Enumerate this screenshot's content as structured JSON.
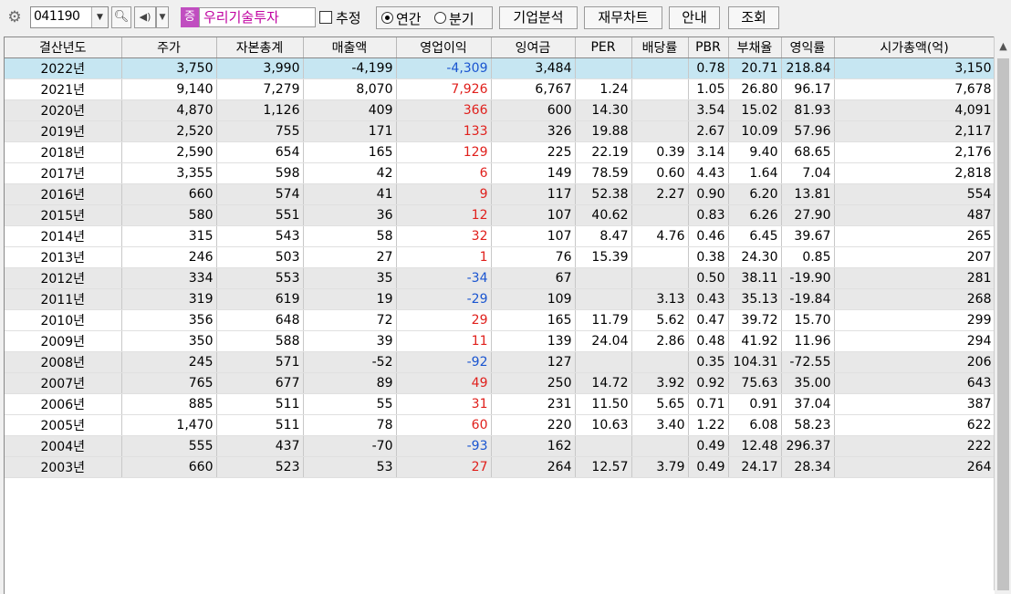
{
  "toolbar": {
    "gear_icon": "gear-icon",
    "stock_code": "041190",
    "market_badge": "증",
    "company_name": "우리기술투자",
    "estimate_label": "추정",
    "estimate_checked": false,
    "annual_label": "연간",
    "quarter_label": "분기",
    "annual_selected": true,
    "btn_company_analysis": "기업분석",
    "btn_financial_chart": "재무차트",
    "btn_guide": "안내",
    "btn_query": "조회"
  },
  "table": {
    "columns": [
      "결산년도",
      "주가",
      "자본총계",
      "매출액",
      "영업이익",
      "잉여금",
      "PER",
      "배당률",
      "PBR",
      "부채율",
      "영익률",
      "시가총액(억)"
    ],
    "rows": [
      {
        "year": "2022년",
        "price": "3,750",
        "equity": "3,990",
        "sales": "-4,199",
        "op": "-4,309",
        "op_color": "blue",
        "surplus": "3,484",
        "per": "",
        "div": "",
        "pbr": "0.78",
        "debt": "20.71",
        "opm": "218.84",
        "mcap": "3,150",
        "style": "sel"
      },
      {
        "year": "2021년",
        "price": "9,140",
        "equity": "7,279",
        "sales": "8,070",
        "op": "7,926",
        "op_color": "red",
        "surplus": "6,767",
        "per": "1.24",
        "div": "",
        "pbr": "1.05",
        "debt": "26.80",
        "opm": "96.17",
        "mcap": "7,678",
        "style": "white"
      },
      {
        "year": "2020년",
        "price": "4,870",
        "equity": "1,126",
        "sales": "409",
        "op": "366",
        "op_color": "red",
        "surplus": "600",
        "per": "14.30",
        "div": "",
        "pbr": "3.54",
        "debt": "15.02",
        "opm": "81.93",
        "mcap": "4,091",
        "style": "gray"
      },
      {
        "year": "2019년",
        "price": "2,520",
        "equity": "755",
        "sales": "171",
        "op": "133",
        "op_color": "red",
        "surplus": "326",
        "per": "19.88",
        "div": "",
        "pbr": "2.67",
        "debt": "10.09",
        "opm": "57.96",
        "mcap": "2,117",
        "style": "gray"
      },
      {
        "year": "2018년",
        "price": "2,590",
        "equity": "654",
        "sales": "165",
        "op": "129",
        "op_color": "red",
        "surplus": "225",
        "per": "22.19",
        "div": "0.39",
        "pbr": "3.14",
        "debt": "9.40",
        "opm": "68.65",
        "mcap": "2,176",
        "style": "white"
      },
      {
        "year": "2017년",
        "price": "3,355",
        "equity": "598",
        "sales": "42",
        "op": "6",
        "op_color": "red",
        "surplus": "149",
        "per": "78.59",
        "div": "0.60",
        "pbr": "4.43",
        "debt": "1.64",
        "opm": "7.04",
        "mcap": "2,818",
        "style": "white"
      },
      {
        "year": "2016년",
        "price": "660",
        "equity": "574",
        "sales": "41",
        "op": "9",
        "op_color": "red",
        "surplus": "117",
        "per": "52.38",
        "div": "2.27",
        "pbr": "0.90",
        "debt": "6.20",
        "opm": "13.81",
        "mcap": "554",
        "style": "gray"
      },
      {
        "year": "2015년",
        "price": "580",
        "equity": "551",
        "sales": "36",
        "op": "12",
        "op_color": "red",
        "surplus": "107",
        "per": "40.62",
        "div": "",
        "pbr": "0.83",
        "debt": "6.26",
        "opm": "27.90",
        "mcap": "487",
        "style": "gray"
      },
      {
        "year": "2014년",
        "price": "315",
        "equity": "543",
        "sales": "58",
        "op": "32",
        "op_color": "red",
        "surplus": "107",
        "per": "8.47",
        "div": "4.76",
        "pbr": "0.46",
        "debt": "6.45",
        "opm": "39.67",
        "mcap": "265",
        "style": "white"
      },
      {
        "year": "2013년",
        "price": "246",
        "equity": "503",
        "sales": "27",
        "op": "1",
        "op_color": "red",
        "surplus": "76",
        "per": "15.39",
        "div": "",
        "pbr": "0.38",
        "debt": "24.30",
        "opm": "0.85",
        "mcap": "207",
        "style": "white"
      },
      {
        "year": "2012년",
        "price": "334",
        "equity": "553",
        "sales": "35",
        "op": "-34",
        "op_color": "blue",
        "surplus": "67",
        "per": "",
        "div": "",
        "pbr": "0.50",
        "debt": "38.11",
        "opm": "-19.90",
        "mcap": "281",
        "style": "gray"
      },
      {
        "year": "2011년",
        "price": "319",
        "equity": "619",
        "sales": "19",
        "op": "-29",
        "op_color": "blue",
        "surplus": "109",
        "per": "",
        "div": "3.13",
        "pbr": "0.43",
        "debt": "35.13",
        "opm": "-19.84",
        "mcap": "268",
        "style": "gray"
      },
      {
        "year": "2010년",
        "price": "356",
        "equity": "648",
        "sales": "72",
        "op": "29",
        "op_color": "red",
        "surplus": "165",
        "per": "11.79",
        "div": "5.62",
        "pbr": "0.47",
        "debt": "39.72",
        "opm": "15.70",
        "mcap": "299",
        "style": "white"
      },
      {
        "year": "2009년",
        "price": "350",
        "equity": "588",
        "sales": "39",
        "op": "11",
        "op_color": "red",
        "surplus": "139",
        "per": "24.04",
        "div": "2.86",
        "pbr": "0.48",
        "debt": "41.92",
        "opm": "11.96",
        "mcap": "294",
        "style": "white"
      },
      {
        "year": "2008년",
        "price": "245",
        "equity": "571",
        "sales": "-52",
        "op": "-92",
        "op_color": "blue",
        "surplus": "127",
        "per": "",
        "div": "",
        "pbr": "0.35",
        "debt": "104.31",
        "opm": "-72.55",
        "mcap": "206",
        "style": "gray"
      },
      {
        "year": "2007년",
        "price": "765",
        "equity": "677",
        "sales": "89",
        "op": "49",
        "op_color": "red",
        "surplus": "250",
        "per": "14.72",
        "div": "3.92",
        "pbr": "0.92",
        "debt": "75.63",
        "opm": "35.00",
        "mcap": "643",
        "style": "gray"
      },
      {
        "year": "2006년",
        "price": "885",
        "equity": "511",
        "sales": "55",
        "op": "31",
        "op_color": "red",
        "surplus": "231",
        "per": "11.50",
        "div": "5.65",
        "pbr": "0.71",
        "debt": "0.91",
        "opm": "37.04",
        "mcap": "387",
        "style": "white"
      },
      {
        "year": "2005년",
        "price": "1,470",
        "equity": "511",
        "sales": "78",
        "op": "60",
        "op_color": "red",
        "surplus": "220",
        "per": "10.63",
        "div": "3.40",
        "pbr": "1.22",
        "debt": "6.08",
        "opm": "58.23",
        "mcap": "622",
        "style": "white"
      },
      {
        "year": "2004년",
        "price": "555",
        "equity": "437",
        "sales": "-70",
        "op": "-93",
        "op_color": "blue",
        "surplus": "162",
        "per": "",
        "div": "",
        "pbr": "0.49",
        "debt": "12.48",
        "opm": "296.37",
        "mcap": "222",
        "style": "gray"
      },
      {
        "year": "2003년",
        "price": "660",
        "equity": "523",
        "sales": "53",
        "op": "27",
        "op_color": "red",
        "surplus": "264",
        "per": "12.57",
        "div": "3.79",
        "pbr": "0.49",
        "debt": "24.17",
        "opm": "28.34",
        "mcap": "264",
        "style": "gray"
      }
    ]
  },
  "colors": {
    "positive_op": "#e0201c",
    "negative_op": "#1a55d0",
    "selected_row": "#c6e6f2",
    "alt_row": "#e8e8e8",
    "company_name": "#c000a0",
    "market_badge": "#c04ec0"
  }
}
